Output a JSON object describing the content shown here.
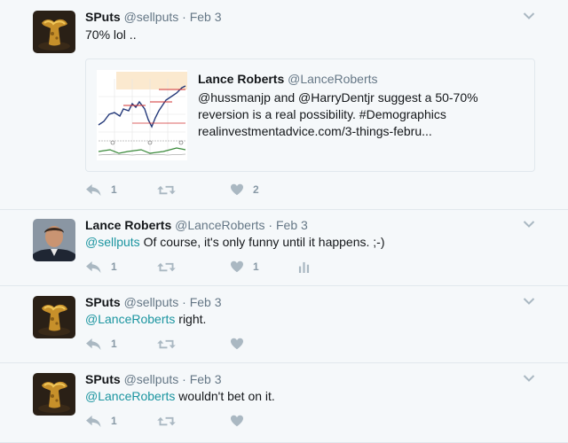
{
  "tweets": [
    {
      "name": "SPuts",
      "handle": "@sellputs",
      "sep": "·",
      "time": "Feb 3",
      "text": "70% lol ..",
      "quote": {
        "name": "Lance Roberts",
        "handle": "@LanceRoberts",
        "line1": "@hussmanjp and @HarryDentjr suggest a 50-70%",
        "line2": "reversion is a real possibility. #Demographics",
        "line3": "realinvestmentadvice.com/3-things-febru..."
      },
      "reply_count": "1",
      "retweet_count": "",
      "like_count": "2"
    },
    {
      "name": "Lance Roberts",
      "handle": "@LanceRoberts",
      "sep": "·",
      "time": "Feb 3",
      "mention": "@sellputs",
      "text": " Of course, it's only funny until it happens. ;-)",
      "reply_count": "1",
      "retweet_count": "",
      "like_count": "1"
    },
    {
      "name": "SPuts",
      "handle": "@sellputs",
      "sep": "·",
      "time": "Feb 3",
      "mention": "@LanceRoberts",
      "text": " right.",
      "reply_count": "1",
      "retweet_count": "",
      "like_count": ""
    },
    {
      "name": "SPuts",
      "handle": "@sellputs",
      "sep": "·",
      "time": "Feb 3",
      "mention": "@LanceRoberts",
      "text": " wouldn't bet on it.",
      "reply_count": "1",
      "retweet_count": "",
      "like_count": ""
    }
  ],
  "icons": {
    "reply": "reply-icon",
    "retweet": "retweet-icon",
    "like": "heart-icon",
    "analytics": "analytics-icon",
    "more": "chevron-down-icon"
  },
  "colors": {
    "mention": "#1b95a0",
    "meta": "#657786",
    "action": "#aab8c2",
    "background": "#f5f8fa"
  }
}
